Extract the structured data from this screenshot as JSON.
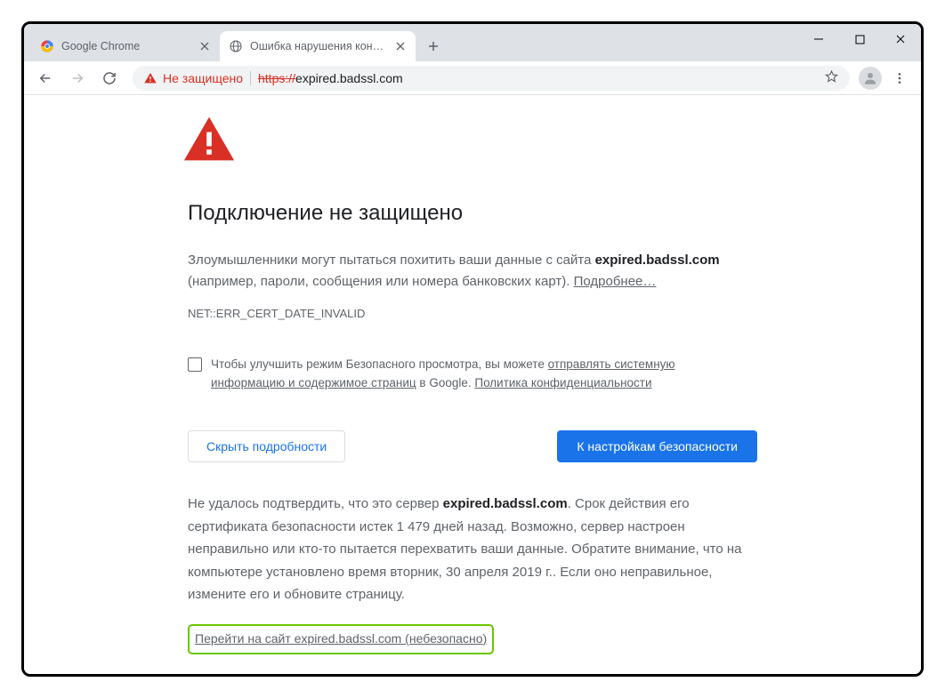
{
  "window": {
    "tabs": [
      {
        "title": "Google Chrome",
        "active": false
      },
      {
        "title": "Ошибка нарушения конфиденц",
        "active": true
      }
    ]
  },
  "toolbar": {
    "not_secure_label": "Не защищено",
    "url_scheme": "https://",
    "url_host": "expired.badssl.com"
  },
  "page": {
    "heading": "Подключение не защищено",
    "intro_prefix": "Злоумышленники могут пытаться похитить ваши данные с сайта ",
    "intro_domain": "expired.badssl.com",
    "intro_suffix": " (например, пароли, сообщения или номера банковских карт). ",
    "learn_more": "Подробнее…",
    "error_code": "NET::ERR_CERT_DATE_INVALID",
    "optin_prefix": "Чтобы улучшить режим Безопасного просмотра, вы можете ",
    "optin_link1": "отправлять системную информацию и содержимое страниц",
    "optin_mid": " в Google. ",
    "optin_link2": "Политика конфиденциальности",
    "hide_details": "Скрыть подробности",
    "safety_settings": "К настройкам безопасности",
    "details_p1a": "Не удалось подтвердить, что это сервер ",
    "details_domain": "expired.badssl.com",
    "details_p1b": ". Срок действия его сертификата безопасности истек 1 479 дней назад. Возможно, сервер настроен неправильно или кто-то пытается перехватить ваши данные. Обратите внимание, что на компьютере установлено время вторник, 30 апреля 2019 г.. Если оно неправильное, измените его и обновите страницу.",
    "proceed": "Перейти на сайт expired.badssl.com (небезопасно)"
  }
}
